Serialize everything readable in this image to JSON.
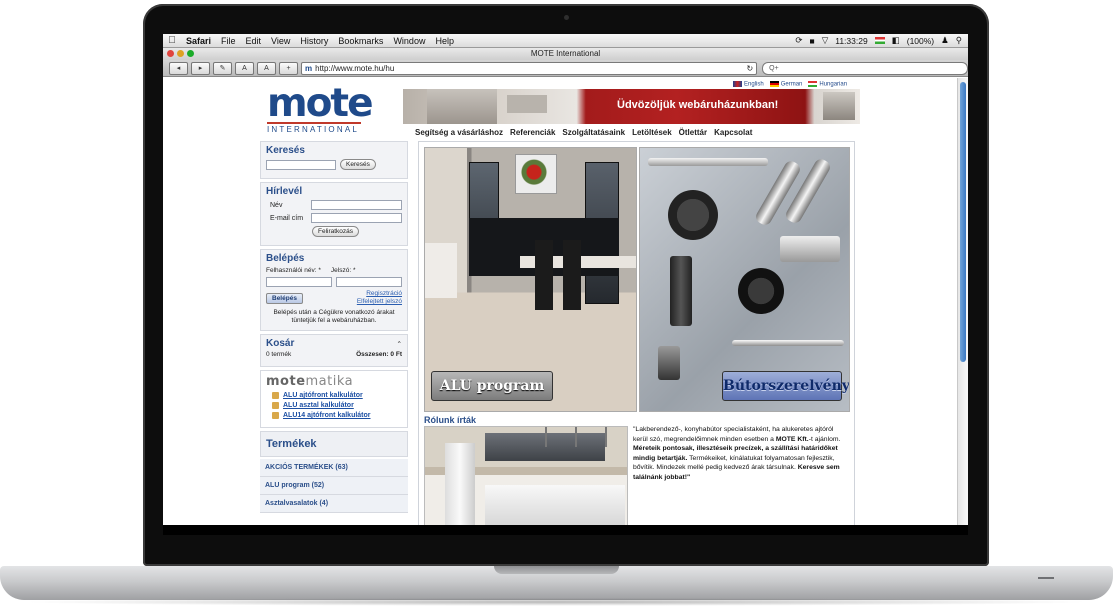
{
  "menubar": {
    "apple": "",
    "items": [
      "Safari",
      "File",
      "Edit",
      "View",
      "History",
      "Bookmarks",
      "Window",
      "Help"
    ],
    "clock": "11:33:29",
    "battery": "(100%)"
  },
  "window": {
    "title": "MOTE International",
    "url": "http://www.mote.hu/hu",
    "search_placeholder": "Q+"
  },
  "toolbar": {
    "back": "◂",
    "forward": "▸",
    "font_small": "A",
    "font_large": "A",
    "add": "+"
  },
  "site": {
    "logo": "mote",
    "logo_sub": "INTERNATIONAL",
    "languages": [
      "English",
      "German",
      "Hungarian"
    ],
    "banner_text": "Üdvözöljük webáruházunkban!",
    "nav": [
      "Segítség a vásárláshoz",
      "Referenciák",
      "Szolgáltatásaink",
      "Letöltések",
      "Ötlettár",
      "Kapcsolat"
    ]
  },
  "search": {
    "title": "Keresés",
    "button": "Keresés"
  },
  "newsletter": {
    "title": "Hírlevél",
    "name_label": "Név",
    "email_label": "E-mail cím",
    "button": "Feliratkozás"
  },
  "login": {
    "title": "Belépés",
    "user_label": "Felhasználói név: *",
    "pass_label": "Jelszó: *",
    "button": "Belépés",
    "register": "Regisztráció",
    "forgot": "Elfelejtett jelszó",
    "info": "Belépés után a Cégükre vonatkozó árakat tüntetjük fel a webáruházban."
  },
  "cart": {
    "title": "Kosár",
    "items": "0 termék",
    "total_label": "Összesen: 0 Ft",
    "toggle": "⌃"
  },
  "motematika": {
    "logo_a": "mote",
    "logo_b": "matika",
    "calculators": [
      "ALU ajtófront kalkulátor",
      "ALU asztal kalkulátor",
      "ALU14 ajtófront kalkulátor"
    ]
  },
  "products": {
    "title": "Termékek",
    "items": [
      "AKCIÓS TERMÉKEK (63)",
      "ALU program (52)",
      "Asztalvasalatok (4)"
    ]
  },
  "tiles": {
    "alu": "ALU program",
    "butor": "Bútorszerelvények"
  },
  "rolunk": {
    "title": "Rólunk írták",
    "quote_parts": [
      "\"Lakberendező-, konyhabútor specialistaként, ha alukeretes ajtóról kerül szó, megrendelőimnek minden esetben a ",
      "MOTE Kft.",
      "-t ajánlom. ",
      "Méreteik pontosak, illesztéseik precízek, a szállítási határidőket mindig betartják.",
      " Termékeiket, kínálatukat folyamatosan fejlesztik, bővítik.",
      " Mindezek mellé pedig kedvező árak társulnak. ",
      "Keresve sem találnánk jobbat!\""
    ]
  },
  "colors": {
    "brand": "#1f4a8a",
    "banner_red": "#a31b1b",
    "link": "#2a5db0"
  }
}
